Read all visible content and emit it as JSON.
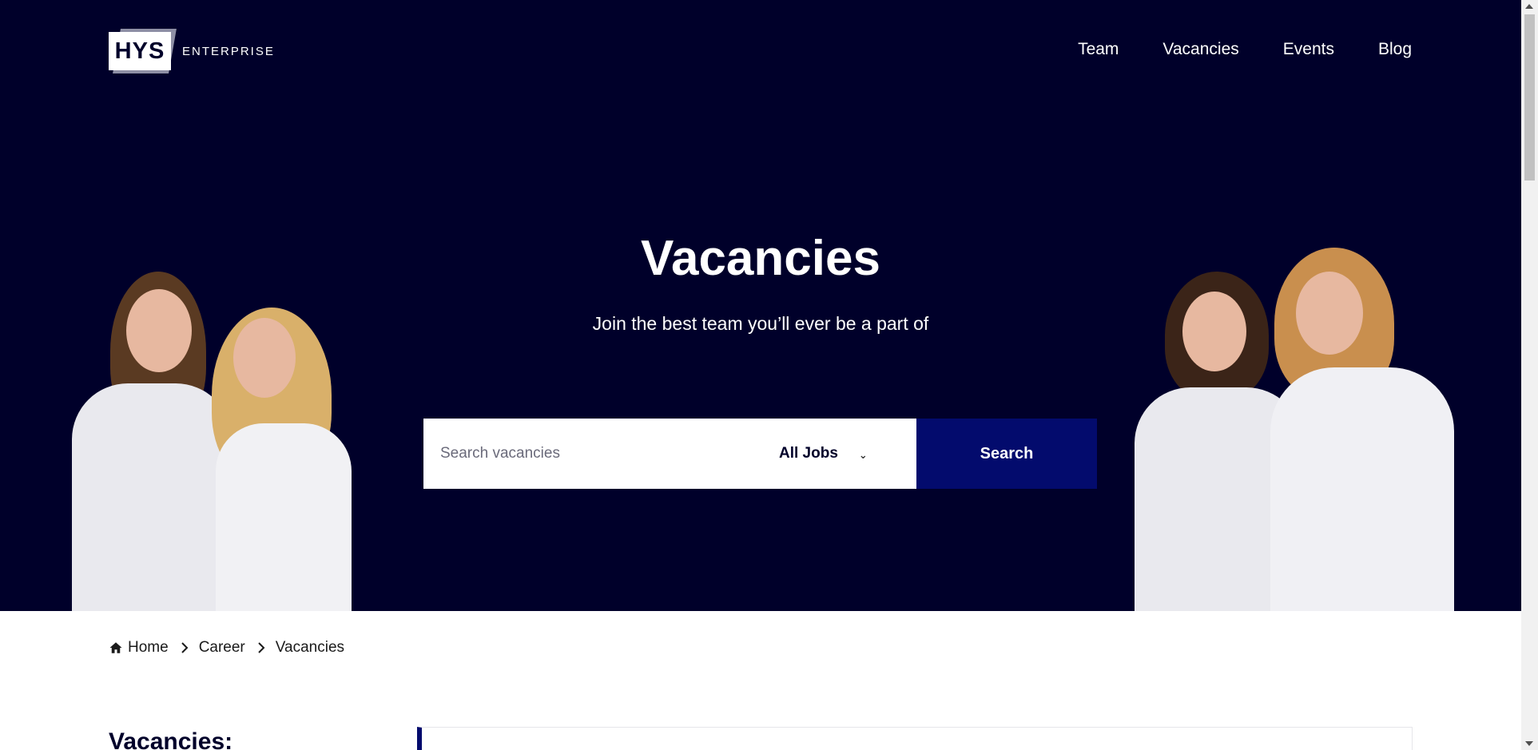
{
  "brand": {
    "logo_text": "HYS",
    "logo_sub": "ENTERPRISE"
  },
  "nav": {
    "items": [
      {
        "label": "Team"
      },
      {
        "label": "Vacancies"
      },
      {
        "label": "Events"
      },
      {
        "label": "Blog"
      }
    ]
  },
  "hero": {
    "title": "Vacancies",
    "subtitle": "Join the best team you’ll ever be a part of"
  },
  "search": {
    "placeholder": "Search vacancies",
    "value": "",
    "category_selected": "All Jobs",
    "button_label": "Search"
  },
  "breadcrumb": {
    "items": [
      {
        "label": "Home"
      },
      {
        "label": "Career"
      },
      {
        "label": "Vacancies"
      }
    ]
  },
  "content": {
    "section_title": "Vacancies:"
  },
  "colors": {
    "hero_bg": "#00002a",
    "accent": "#030b6d",
    "text_dark": "#00002a"
  },
  "icons": {
    "home": "home-icon",
    "breadcrumb_separator": "chevron-right-icon",
    "dropdown": "chevron-down-icon"
  }
}
